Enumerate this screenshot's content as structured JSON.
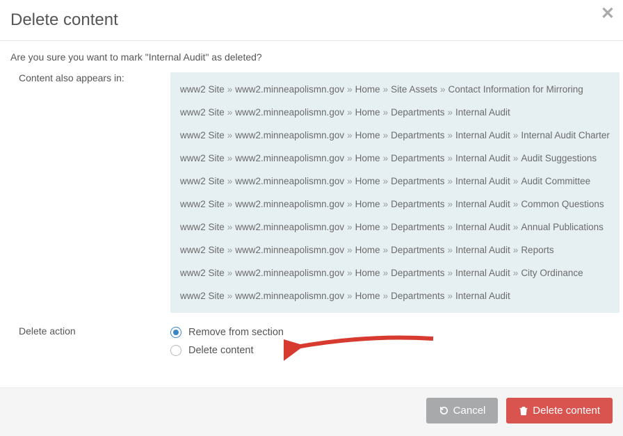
{
  "header": {
    "title": "Delete content"
  },
  "body": {
    "confirm_text": "Are you sure you want to mark \"Internal Audit\" as deleted?",
    "appears_label": "Content also appears in:",
    "breadcrumbs": [
      [
        "www2 Site",
        "www2.minneapolismn.gov",
        "Home",
        "Site Assets",
        "Contact Information for Mirroring"
      ],
      [
        "www2 Site",
        "www2.minneapolismn.gov",
        "Home",
        "Departments",
        "Internal Audit"
      ],
      [
        "www2 Site",
        "www2.minneapolismn.gov",
        "Home",
        "Departments",
        "Internal Audit",
        "Internal Audit Charter"
      ],
      [
        "www2 Site",
        "www2.minneapolismn.gov",
        "Home",
        "Departments",
        "Internal Audit",
        "Audit Suggestions"
      ],
      [
        "www2 Site",
        "www2.minneapolismn.gov",
        "Home",
        "Departments",
        "Internal Audit",
        "Audit Committee"
      ],
      [
        "www2 Site",
        "www2.minneapolismn.gov",
        "Home",
        "Departments",
        "Internal Audit",
        "Common Questions"
      ],
      [
        "www2 Site",
        "www2.minneapolismn.gov",
        "Home",
        "Departments",
        "Internal Audit",
        "Annual Publications"
      ],
      [
        "www2 Site",
        "www2.minneapolismn.gov",
        "Home",
        "Departments",
        "Internal Audit",
        "Reports"
      ],
      [
        "www2 Site",
        "www2.minneapolismn.gov",
        "Home",
        "Departments",
        "Internal Audit",
        "City Ordinance"
      ],
      [
        "www2 Site",
        "www2.minneapolismn.gov",
        "Home",
        "Departments",
        "Internal Audit"
      ]
    ],
    "delete_action_label": "Delete action",
    "radio_options": [
      {
        "label": "Remove from section",
        "selected": true
      },
      {
        "label": "Delete content",
        "selected": false
      }
    ]
  },
  "footer": {
    "cancel_label": "Cancel",
    "delete_label": "Delete content"
  },
  "colors": {
    "danger": "#d9534f",
    "secondary": "#a7a9aa",
    "arrow": "#d73a2e"
  }
}
